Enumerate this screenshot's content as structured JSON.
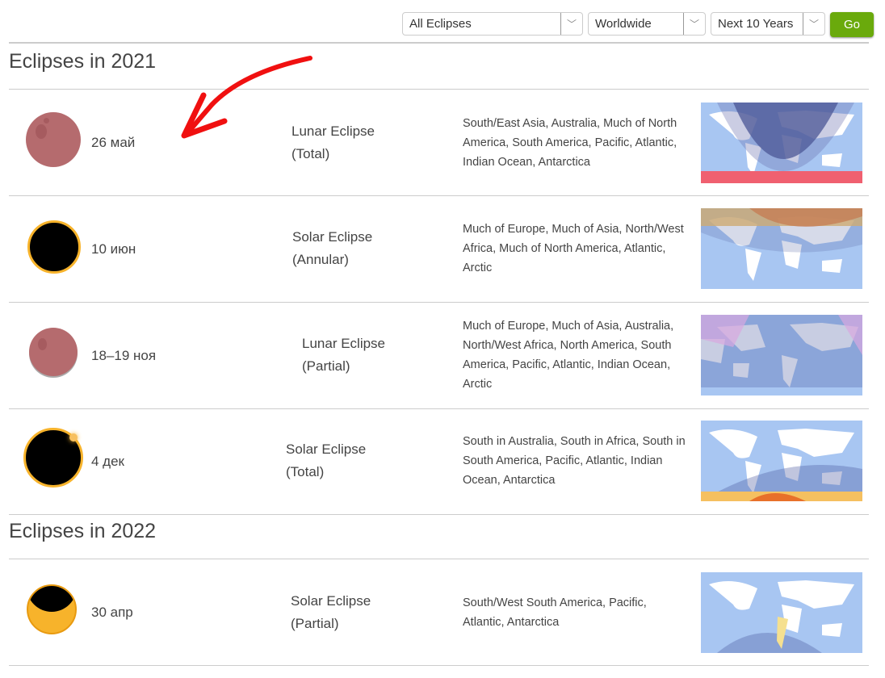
{
  "filters": {
    "type": "All Eclipses",
    "region": "Worldwide",
    "period": "Next 10 Years",
    "go_label": "Go"
  },
  "sections": [
    {
      "heading": "Eclipses in 2021",
      "eclipses": [
        {
          "date": "26 май",
          "type": "Lunar Eclipse",
          "subtype": "(Total)",
          "visibility": "South/East Asia, Australia, Much of North America, South America, Pacific, Atlantic, Indian Ocean, Antarctica",
          "icon": "lunar-total-icon"
        },
        {
          "date": "10 июн",
          "type": "Solar Eclipse",
          "subtype": "(Annular)",
          "visibility": "Much of Europe, Much of Asia, North/West Africa, Much of North America, Atlantic, Arctic",
          "icon": "solar-annular-icon"
        },
        {
          "date": "18–19 ноя",
          "type": "Lunar Eclipse",
          "subtype": "(Partial)",
          "visibility": "Much of Europe, Much of Asia, Australia, North/West Africa, North America, South America, Pacific, Atlantic, Indian Ocean, Arctic",
          "icon": "lunar-partial-icon"
        },
        {
          "date": "4 дек",
          "type": "Solar Eclipse",
          "subtype": "(Total)",
          "visibility": "South in Australia, South in Africa, South in South America, Pacific, Atlantic, Indian Ocean, Antarctica",
          "icon": "solar-total-icon"
        }
      ]
    },
    {
      "heading": "Eclipses in 2022",
      "eclipses": [
        {
          "date": "30 апр",
          "type": "Solar Eclipse",
          "subtype": "(Partial)",
          "visibility": "South/West South America, Pacific, Atlantic, Antarctica",
          "icon": "solar-partial-icon"
        }
      ]
    }
  ],
  "colors": {
    "go": "#6aaa0c",
    "moon": "#b56b6e",
    "sun": "#f7b32b",
    "ocean": "#a8c6f2"
  }
}
